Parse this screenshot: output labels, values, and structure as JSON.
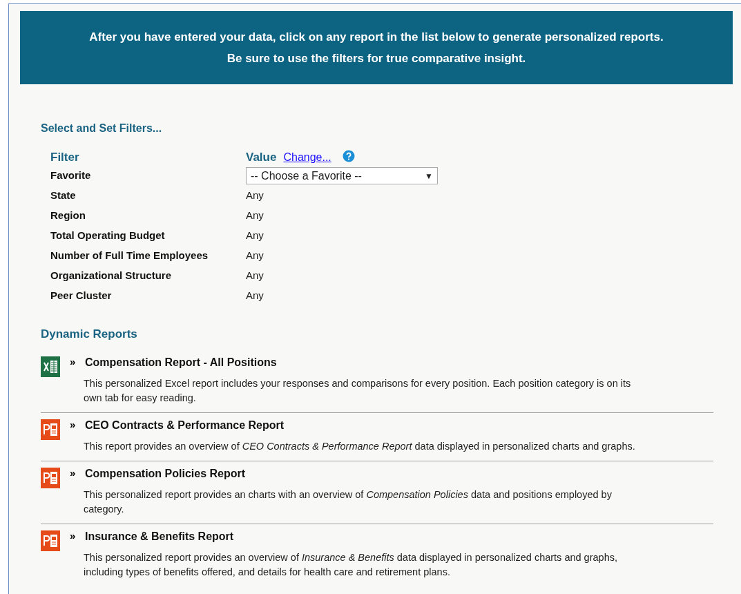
{
  "banner": {
    "lines": [
      "After you have entered your data, click on any report in the list below to generate personalized reports.",
      "Be sure to use the filters for true comparative insight."
    ]
  },
  "filters": {
    "heading": "Select and Set Filters...",
    "column_filter": "Filter",
    "column_value": "Value",
    "change_link": "Change...",
    "rows": [
      {
        "label": "Favorite",
        "kind": "select",
        "value": "-- Choose a Favorite --",
        "arrow": "▼"
      },
      {
        "label": "State",
        "kind": "text",
        "value": "Any"
      },
      {
        "label": "Region",
        "kind": "text",
        "value": "Any"
      },
      {
        "label": "Total Operating Budget",
        "kind": "text",
        "value": "Any"
      },
      {
        "label": "Number of Full Time Employees",
        "kind": "text",
        "value": "Any"
      },
      {
        "label": "Organizational Structure",
        "kind": "text",
        "value": "Any"
      },
      {
        "label": "Peer Cluster",
        "kind": "text",
        "value": "Any"
      }
    ]
  },
  "reports": {
    "heading": "Dynamic Reports",
    "items": [
      {
        "kind": "excel",
        "marker": "»",
        "title": "Compensation Report - All Positions",
        "description": "This personalized Excel report includes your responses and comparisons for every position. Each position category is on its own tab for easy reading."
      },
      {
        "kind": "powerpoint",
        "marker": "»",
        "title": "CEO Contracts & Performance Report",
        "description": "This report provides an overview of *CEO Contracts & Performance Report* data displayed in personalized charts and graphs."
      },
      {
        "kind": "powerpoint",
        "marker": "»",
        "title": "Compensation Policies Report",
        "description": "This personalized report provides an charts with an overview of *Compensation Policies* data and positions employed by category."
      },
      {
        "kind": "powerpoint",
        "marker": "»",
        "title": "Insurance & Benefits Report",
        "description": "This personalized report provides an overview of *Insurance & Benefits* data displayed in personalized charts and graphs, including types of benefits offered, and details for health care and retirement plans."
      }
    ]
  }
}
